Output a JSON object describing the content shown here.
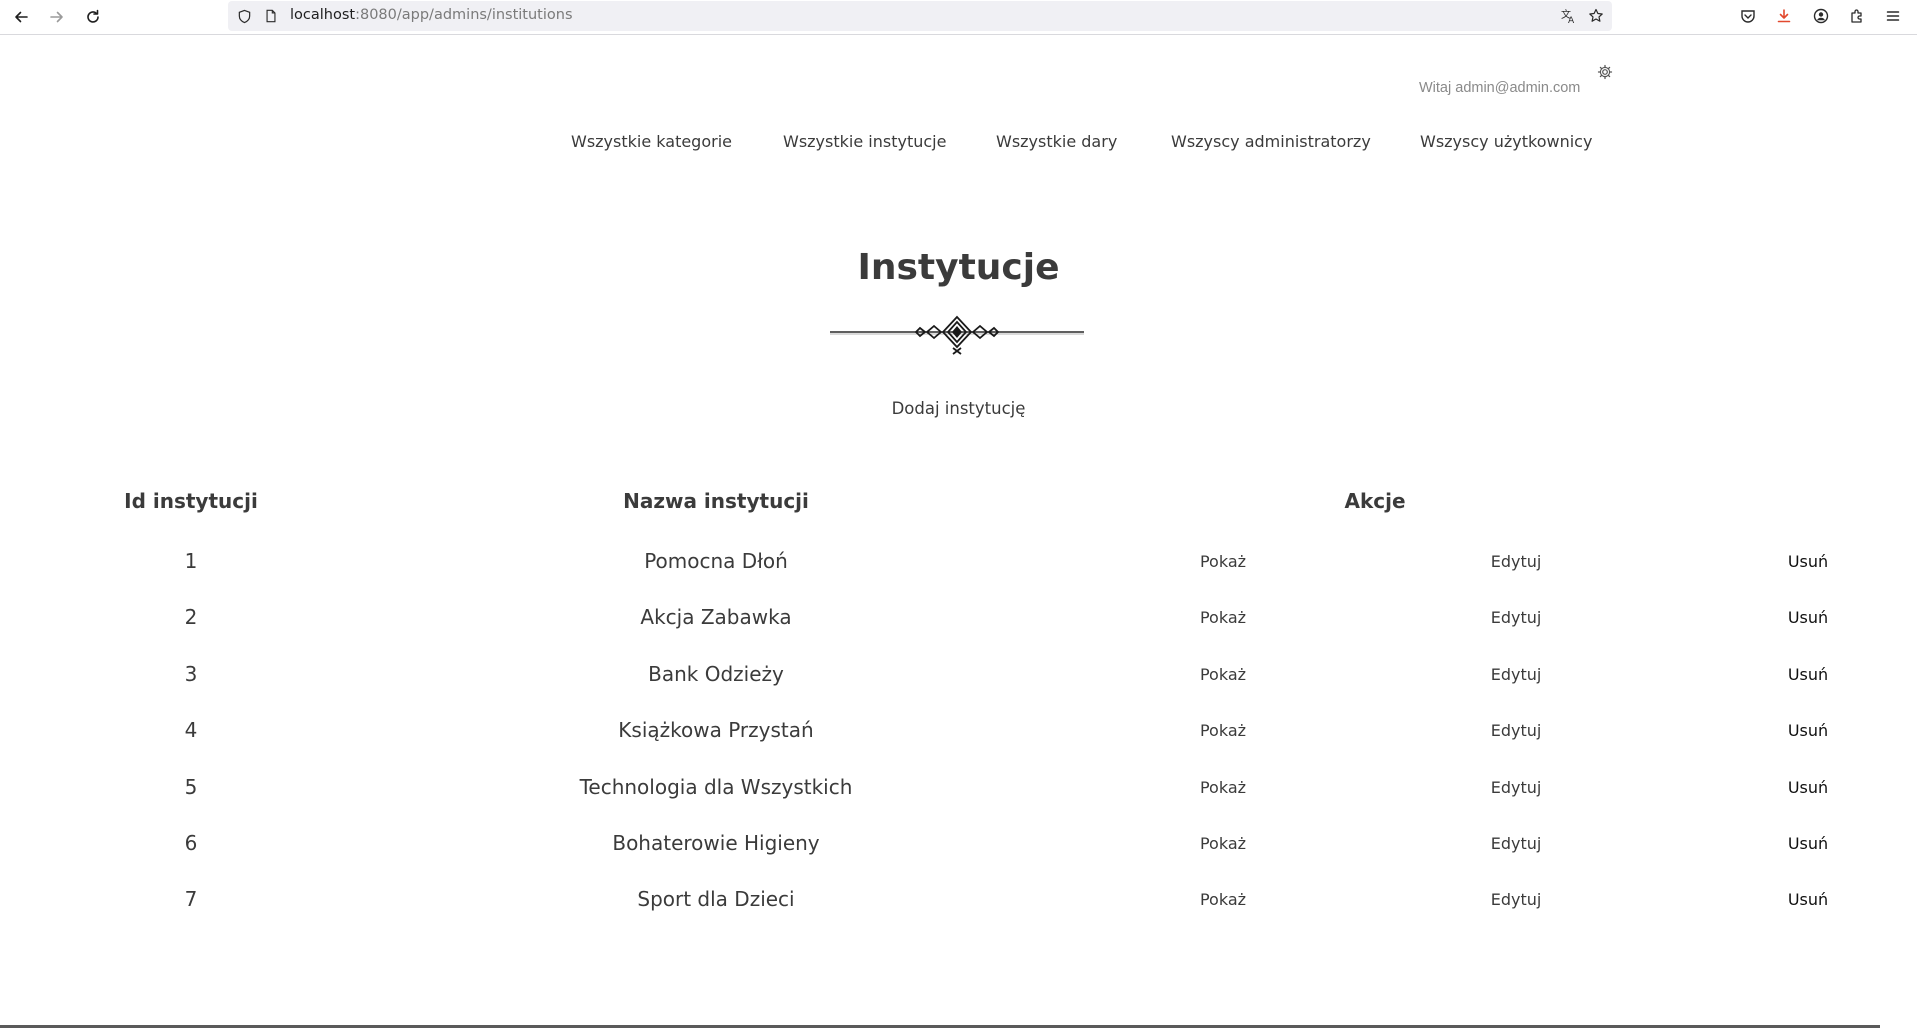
{
  "browser": {
    "url_host": "localhost",
    "url_rest": ":8080/app/admins/institutions"
  },
  "header": {
    "greeting": "Witaj admin@admin.com"
  },
  "nav": {
    "items": [
      {
        "label": "Wszystkie kategorie"
      },
      {
        "label": "Wszystkie instytucje"
      },
      {
        "label": "Wszystkie dary"
      },
      {
        "label": "Wszyscy administratorzy"
      },
      {
        "label": "Wszyscy użytkownicy"
      }
    ]
  },
  "main": {
    "title": "Instytucje",
    "add_label": "Dodaj instytucję"
  },
  "table": {
    "headers": [
      "Id instytucji",
      "Nazwa instytucji",
      "Akcje"
    ],
    "actions": {
      "show": "Pokaż",
      "edit": "Edytuj",
      "delete": "Usuń"
    },
    "rows": [
      {
        "id": "1",
        "name": "Pomocna Dłoń"
      },
      {
        "id": "2",
        "name": "Akcja Zabawka"
      },
      {
        "id": "3",
        "name": "Bank Odzieży"
      },
      {
        "id": "4",
        "name": "Książkowa Przystań"
      },
      {
        "id": "5",
        "name": "Technologia dla Wszystkich"
      },
      {
        "id": "6",
        "name": "Bohaterowie Higieny"
      },
      {
        "id": "7",
        "name": "Sport dla Dzieci"
      }
    ]
  }
}
